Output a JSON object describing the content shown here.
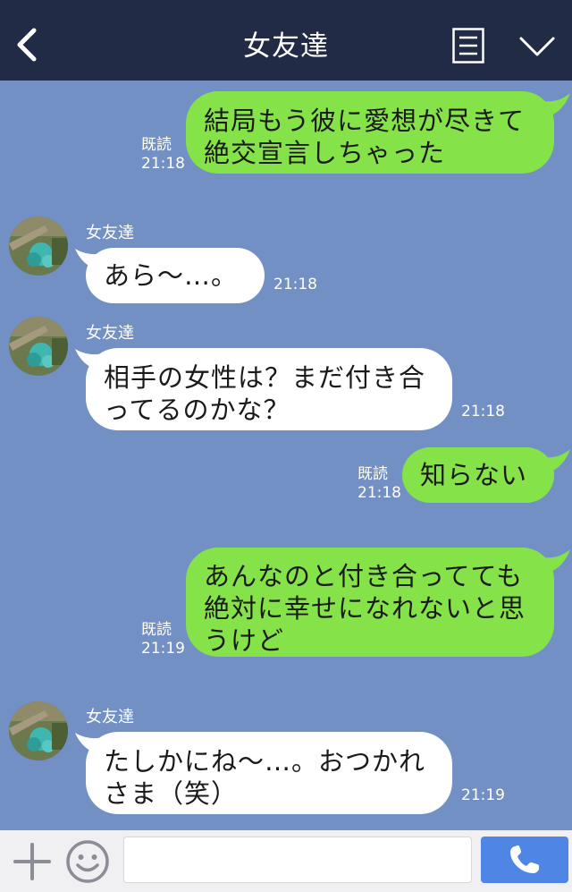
{
  "header": {
    "title": "女友達",
    "back_icon": "chevron-left-icon",
    "menu_icon": "list-icon",
    "expand_icon": "chevron-down-icon"
  },
  "messages": [
    {
      "from": "me",
      "read": "既読",
      "time": "21:18",
      "lines": [
        "結局もう彼に愛想が尽きて",
        "絶交宣言しちゃった"
      ]
    },
    {
      "from": "friend",
      "sender": "女友達",
      "time": "21:18",
      "lines": [
        "あら〜…。"
      ]
    },
    {
      "from": "friend",
      "sender": "女友達",
      "time": "21:18",
      "lines": [
        "相手の女性は？まだ付き合",
        "ってるのかな？"
      ]
    },
    {
      "from": "me",
      "read": "既読",
      "time": "21:18",
      "lines": [
        "知らない"
      ]
    },
    {
      "from": "me",
      "read": "既読",
      "time": "21:19",
      "lines": [
        "あんなのと付き合ってても",
        "絶対に幸せになれないと思",
        "うけど"
      ]
    },
    {
      "from": "friend",
      "sender": "女友達",
      "time": "21:19",
      "lines": [
        "たしかにね〜…。おつかれ",
        "さま（笑）"
      ]
    }
  ],
  "input_bar": {
    "placeholder": "",
    "value": "",
    "plus_icon": "plus-icon",
    "emoji_icon": "smiley-icon",
    "call_icon": "phone-icon"
  },
  "colors": {
    "header_bg": "#212b45",
    "chat_bg": "#7290c4",
    "my_bubble": "#85e249",
    "friend_bubble": "#ffffff",
    "call_button": "#4f86e6"
  }
}
